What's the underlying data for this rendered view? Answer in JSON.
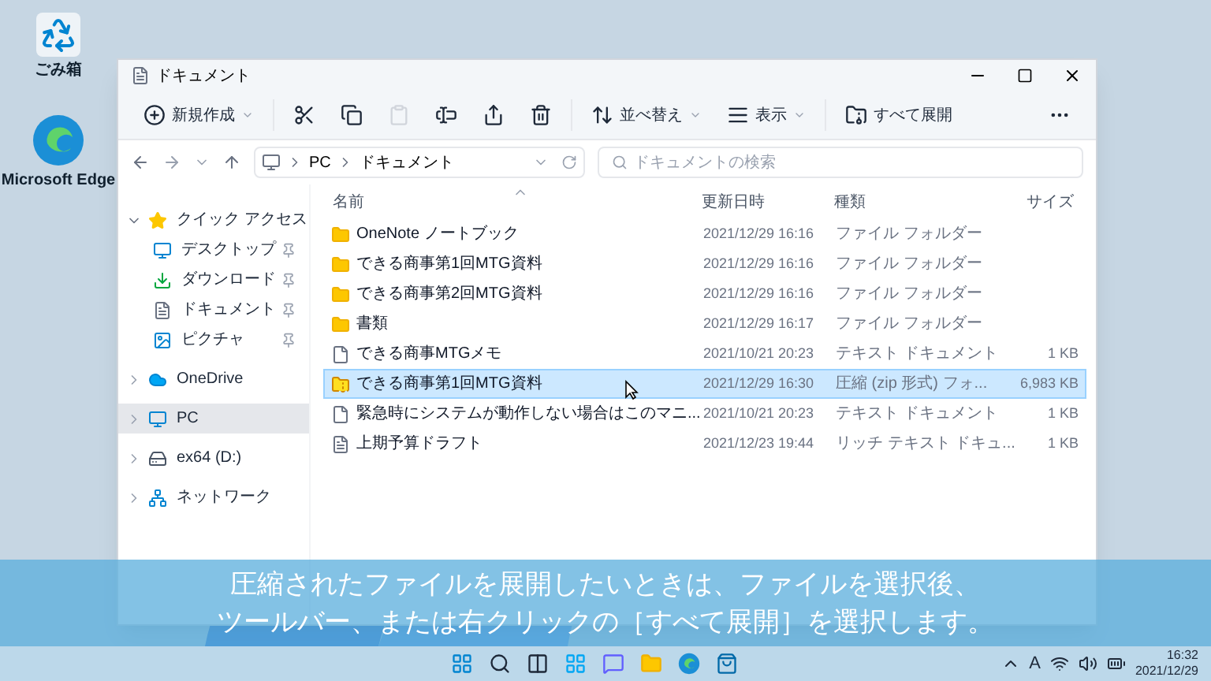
{
  "desktop_icons": [
    {
      "label": "ごみ箱",
      "kind": "bin"
    },
    {
      "label": "Microsoft Edge",
      "kind": "browser"
    }
  ],
  "window": {
    "title": "ドキュメント"
  },
  "toolbar": [
    {
      "kind": "new",
      "label": "新規作成",
      "disabled": false
    },
    {
      "kind": "cut",
      "disabled": false
    },
    {
      "kind": "copy",
      "disabled": false
    },
    {
      "kind": "paste",
      "disabled": true
    },
    {
      "kind": "rename",
      "disabled": false
    },
    {
      "kind": "share",
      "disabled": false
    },
    {
      "kind": "delete",
      "disabled": false
    },
    {
      "kind": "sort",
      "label": "並べ替え",
      "disabled": false
    },
    {
      "kind": "view",
      "label": "表示",
      "disabled": false
    },
    {
      "kind": "extract",
      "label": "すべて展開",
      "disabled": false
    },
    {
      "kind": "more",
      "disabled": false
    }
  ],
  "address": {
    "path": [
      "PC",
      "ドキュメント"
    ]
  },
  "search": {
    "placeholder": "ドキュメントの検索"
  },
  "nav": [
    {
      "label": "クイック アクセス",
      "kind": "star",
      "expanded": true,
      "selected": false,
      "children": [
        {
          "label": "デスクトップ",
          "kind": "desktop",
          "selected": false
        },
        {
          "label": "ダウンロード",
          "kind": "download",
          "selected": false
        },
        {
          "label": "ドキュメント",
          "kind": "document",
          "selected": false
        },
        {
          "label": "ピクチャ",
          "kind": "picture",
          "selected": false
        }
      ]
    },
    {
      "label": "OneDrive",
      "kind": "cloud",
      "expanded": false,
      "selected": false
    },
    {
      "label": "PC",
      "kind": "pc",
      "expanded": false,
      "selected": true
    },
    {
      "label": "ex64 (D:)",
      "kind": "drive",
      "expanded": false,
      "selected": false
    },
    {
      "label": "ネットワーク",
      "kind": "network",
      "expanded": false,
      "selected": false
    }
  ],
  "columns": [
    "名前",
    "更新日時",
    "種類",
    "サイズ"
  ],
  "files": [
    {
      "name": "OneNote ノートブック",
      "date": "2021/12/29 16:16",
      "type": "ファイル フォルダー",
      "kind": "folder",
      "selected": false
    },
    {
      "name": "できる商事第1回MTG資料",
      "date": "2021/12/29 16:16",
      "type": "ファイル フォルダー",
      "kind": "folder",
      "selected": false
    },
    {
      "name": "できる商事第2回MTG資料",
      "date": "2021/12/29 16:16",
      "type": "ファイル フォルダー",
      "kind": "folder",
      "selected": false
    },
    {
      "name": "書類",
      "date": "2021/12/29 16:17",
      "type": "ファイル フォルダー",
      "kind": "folder",
      "selected": false
    },
    {
      "name": "できる商事MTGメモ",
      "date": "2021/10/21 20:23",
      "type": "テキスト ドキュメント",
      "size": "1 KB",
      "kind": "text",
      "selected": false
    },
    {
      "name": "できる商事第1回MTG資料",
      "date": "2021/12/29 16:30",
      "type": "圧縮 (zip 形式) フォ...",
      "size": "6,983 KB",
      "kind": "zip",
      "selected": true
    },
    {
      "name": "緊急時にシステムが動作しない場合はこのマニ...",
      "date": "2021/10/21 20:23",
      "type": "テキスト ドキュメント",
      "size": "1 KB",
      "kind": "text",
      "selected": false
    },
    {
      "name": "上期予算ドラフト",
      "date": "2021/12/23 19:44",
      "type": "リッチ テキスト ドキュ...",
      "size": "1 KB",
      "kind": "rich",
      "selected": false
    }
  ],
  "caption": [
    "圧縮されたファイルを展開したいときは、ファイルを選択後、",
    "ツールバー、または右クリックの［すべて展開］を選択します。"
  ],
  "tray": {
    "ime": "A",
    "time": "16:32",
    "date": "2021/12/29"
  }
}
